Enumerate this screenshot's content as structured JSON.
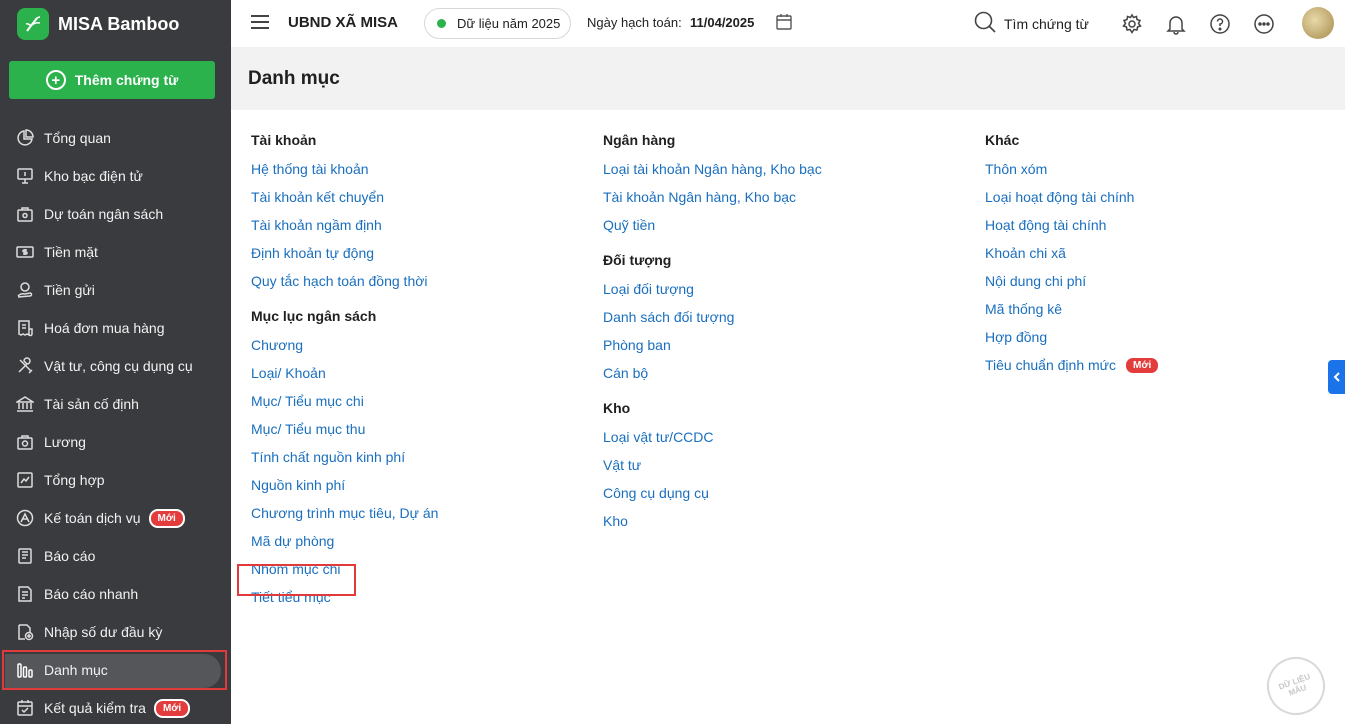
{
  "brand": {
    "name": "MISA Bamboo"
  },
  "sidebar": {
    "add_button": "Thêm chứng từ",
    "items": [
      {
        "label": "Tổng quan",
        "icon": "pie-chart-icon"
      },
      {
        "label": "Kho bạc điện tử",
        "icon": "monitor-icon"
      },
      {
        "label": "Dự toán ngân sách",
        "icon": "budget-icon"
      },
      {
        "label": "Tiền mặt",
        "icon": "cash-icon"
      },
      {
        "label": "Tiền gửi",
        "icon": "deposit-icon"
      },
      {
        "label": "Hoá đơn mua hàng",
        "icon": "invoice-icon"
      },
      {
        "label": "Vật tư, công cụ dụng cụ",
        "icon": "tools-icon"
      },
      {
        "label": "Tài sản cố định",
        "icon": "building-icon"
      },
      {
        "label": "Lương",
        "icon": "salary-icon"
      },
      {
        "label": "Tổng hợp",
        "icon": "summary-icon"
      },
      {
        "label": "Kế toán dịch vụ",
        "icon": "service-icon",
        "badge": "Mới"
      },
      {
        "label": "Báo cáo",
        "icon": "report-icon"
      },
      {
        "label": "Báo cáo nhanh",
        "icon": "quick-report-icon"
      },
      {
        "label": "Nhập số dư đầu kỳ",
        "icon": "opening-balance-icon"
      },
      {
        "label": "Danh mục",
        "icon": "category-icon",
        "active": true
      },
      {
        "label": "Kết quả kiểm tra",
        "icon": "check-result-icon",
        "badge": "Mới"
      }
    ]
  },
  "header": {
    "org_name": "UBND XÃ MISA",
    "year_chip": "Dữ liệu năm 2025",
    "date_label": "Ngày hạch toán:",
    "date_value": "11/04/2025",
    "search_label": "Tìm chứng từ"
  },
  "page": {
    "title": "Danh mục",
    "columns": [
      [
        {
          "title": "Tài khoản",
          "links": [
            "Hệ thống tài khoản",
            "Tài khoản kết chuyển",
            "Tài khoản ngầm định",
            "Định khoản tự động",
            "Quy tắc hạch toán đồng thời"
          ]
        },
        {
          "title": "Mục lục ngân sách",
          "links": [
            "Chương",
            "Loại/ Khoản",
            "Mục/ Tiểu mục chi",
            "Mục/ Tiểu mục thu",
            "Tính chất nguồn kinh phí",
            "Nguồn kinh phí",
            "Chương trình mục tiêu, Dự án",
            "Mã dự phòng",
            "Nhóm mục chi",
            "Tiết tiểu mục"
          ]
        }
      ],
      [
        {
          "title": "Ngân hàng",
          "links": [
            "Loại tài khoản Ngân hàng, Kho bạc",
            "Tài khoản Ngân hàng, Kho bạc",
            "Quỹ tiền"
          ]
        },
        {
          "title": "Đối tượng",
          "links": [
            "Loại đối tượng",
            "Danh sách đối tượng",
            "Phòng ban",
            "Cán bộ"
          ]
        },
        {
          "title": "Kho",
          "links": [
            "Loại vật tư/CCDC",
            "Vật tư",
            "Công cụ dụng cụ",
            "Kho"
          ]
        }
      ],
      [
        {
          "title": "Khác",
          "links": [
            "Thôn xóm",
            "Loại hoạt động tài chính",
            "Hoạt động tài chính",
            "Khoản chi xã",
            "Nội dung chi phí",
            "Mã thống kê",
            "Hợp đồng",
            "Tiêu chuẩn định mức"
          ],
          "badge": "Mới"
        }
      ]
    ]
  },
  "watermark": "DỮ LIỆU MẪU",
  "colors": {
    "sidebar_bg": "#3a3b3e",
    "brand_green": "#2bb24c",
    "link_blue": "#1a6fbf",
    "highlight_red": "#e03a3a"
  }
}
